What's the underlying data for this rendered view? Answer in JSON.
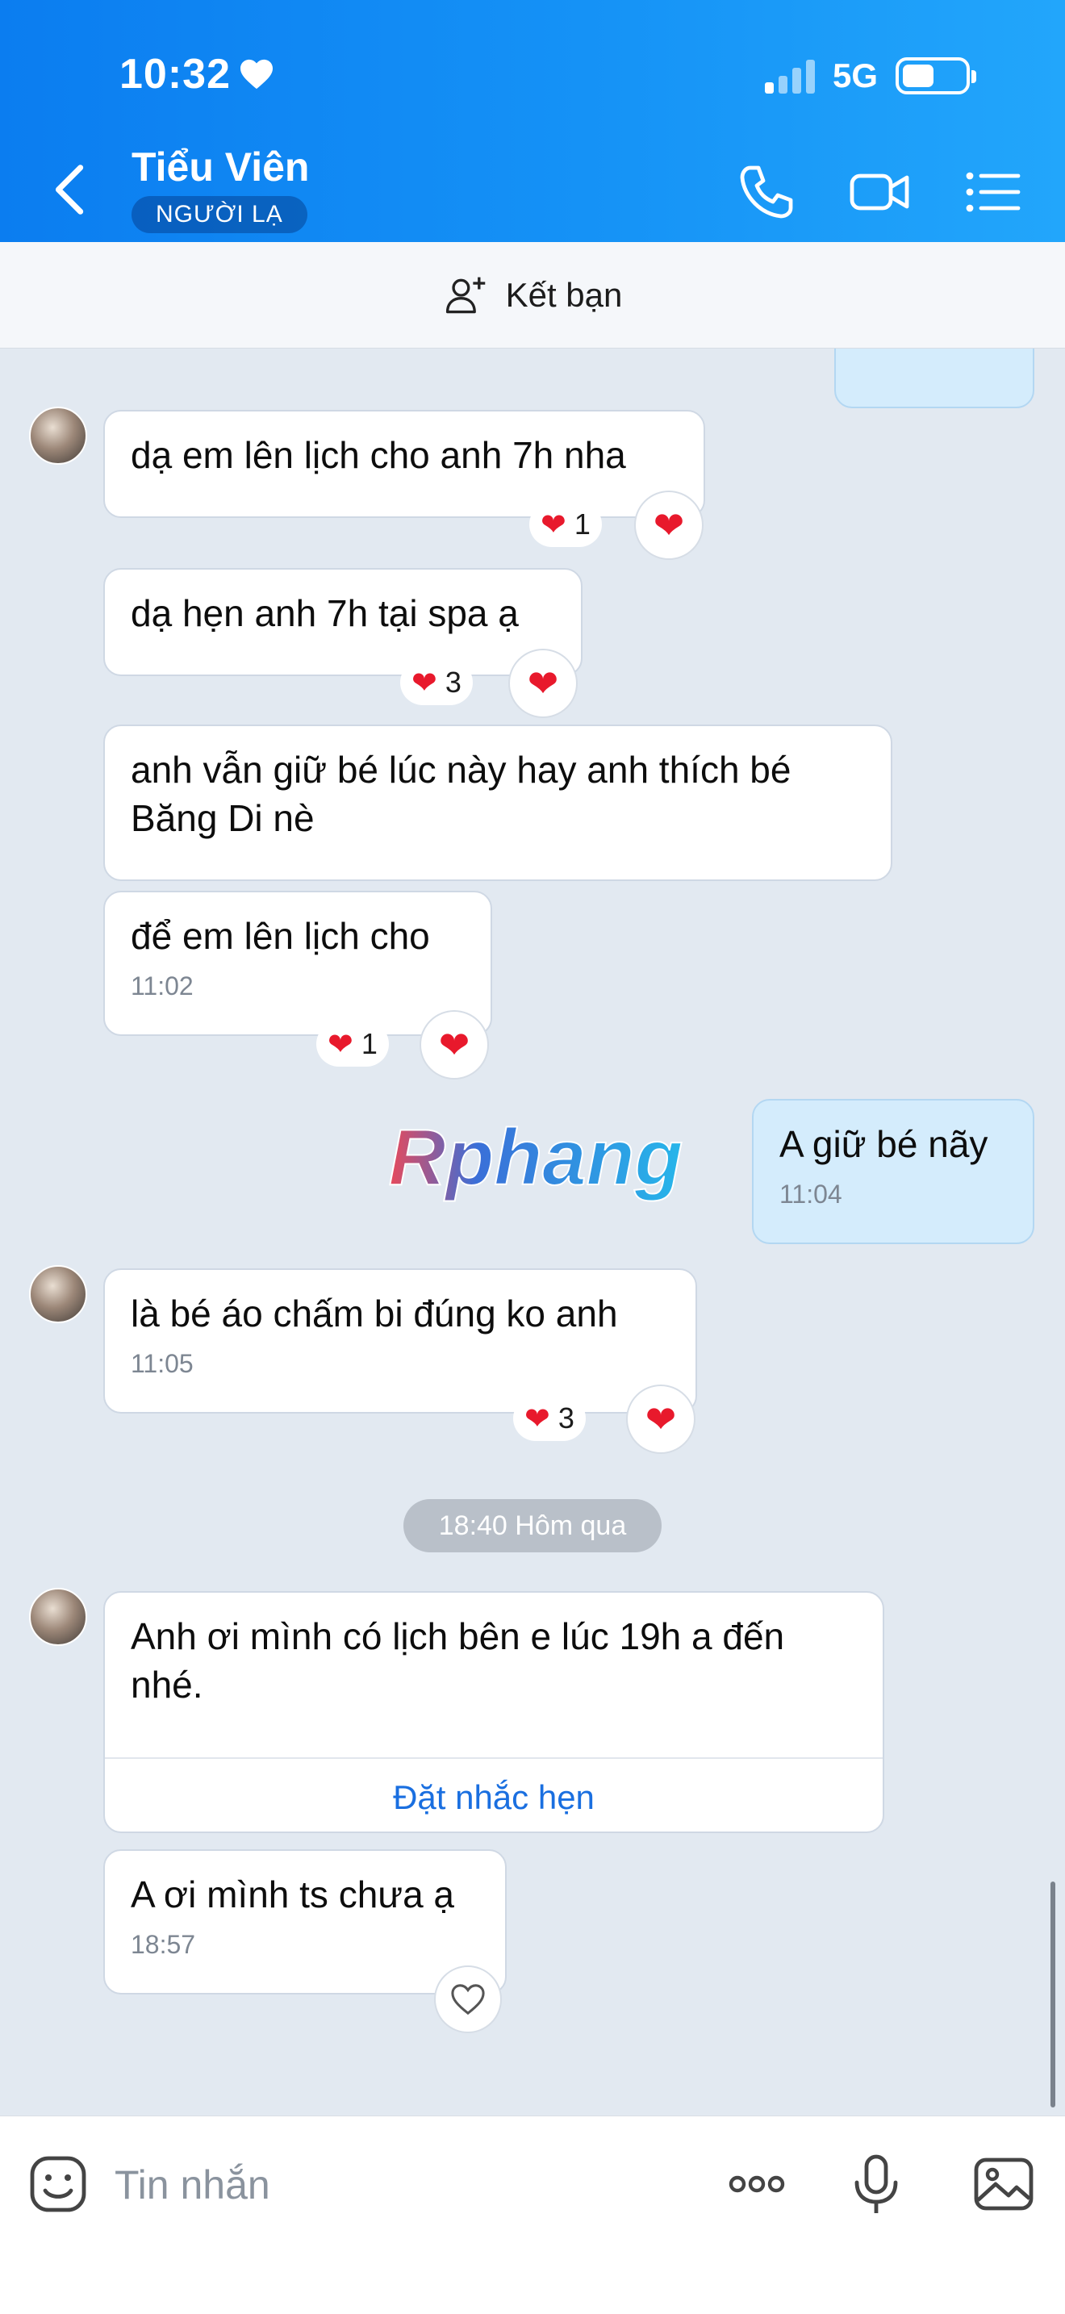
{
  "status": {
    "time": "10:32",
    "network": "5G"
  },
  "header": {
    "contact_name": "Tiểu Viên",
    "badge": "NGƯỜI LẠ"
  },
  "friend_bar": {
    "label": "Kết bạn"
  },
  "messages": [
    {
      "text": "dạ em lên lịch cho anh 7h nha",
      "reaction_count": "1"
    },
    {
      "text": "dạ hẹn anh 7h tại spa ạ",
      "reaction_count": "3"
    },
    {
      "text": "anh vẫn giữ bé lúc này hay anh thích bé Băng Di nè"
    },
    {
      "text": "để em lên lịch cho",
      "time": "11:02",
      "reaction_count": "1"
    },
    {
      "text": "A giữ bé nãy",
      "time": "11:04"
    },
    {
      "text": "là bé áo chấm bi đúng ko anh",
      "time": "11:05",
      "reaction_count": "3"
    },
    {
      "text": "Anh ơi mình có lịch bên e lúc 19h a đến nhé.",
      "action": "Đặt nhắc hẹn"
    },
    {
      "text": "A ơi mình ts chưa ạ",
      "time": "18:57"
    }
  ],
  "date_separator": "18:40 Hôm qua",
  "watermark": "Rphang",
  "input": {
    "placeholder": "Tin nhắn"
  },
  "colors": {
    "header_start": "#0b7df0",
    "header_end": "#22a6fb",
    "chat_bg": "#e2e9f1",
    "outgoing_bubble": "#d4ecfc",
    "heart": "#e8192c",
    "link": "#1a6fe0"
  }
}
